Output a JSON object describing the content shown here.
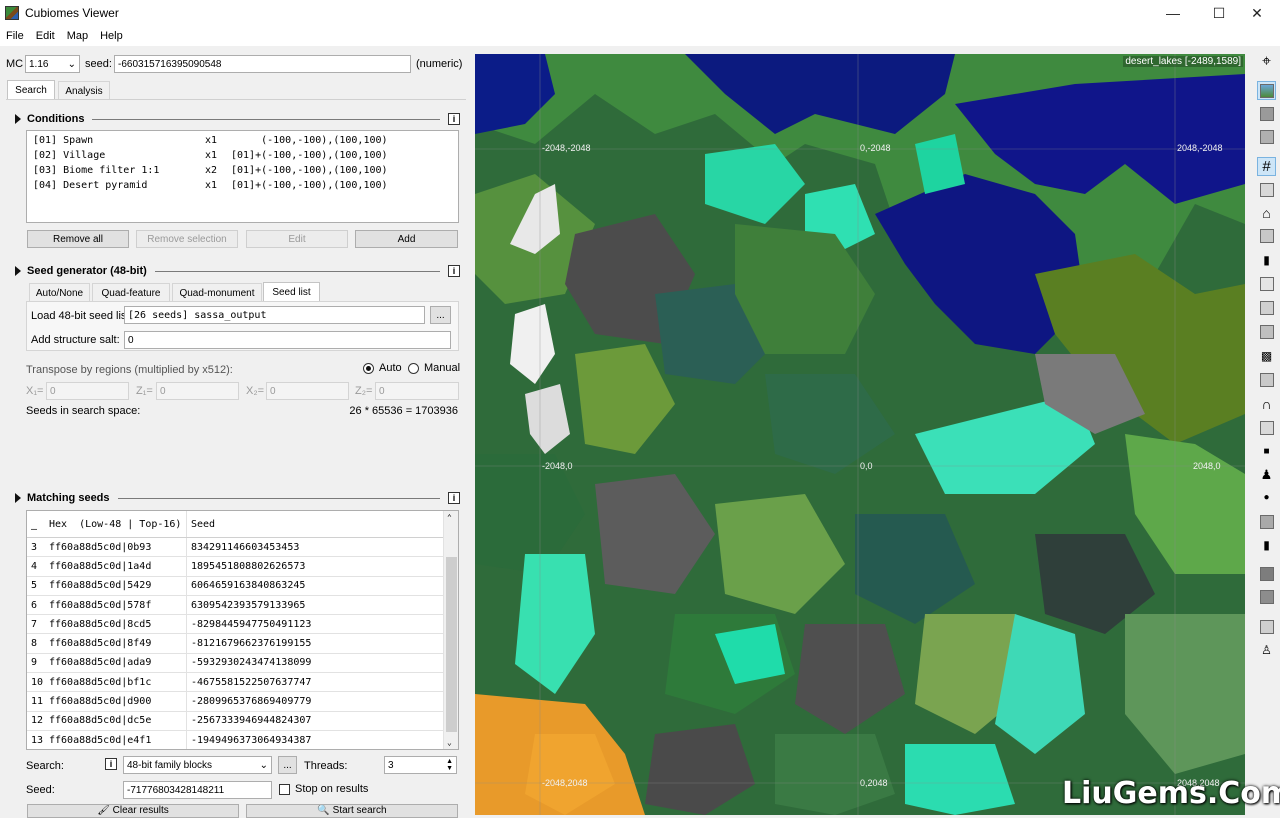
{
  "window": {
    "title": "Cubiomes Viewer",
    "min": "—",
    "max": "☐",
    "close": "✕"
  },
  "menu": [
    "File",
    "Edit",
    "Map",
    "Help"
  ],
  "top": {
    "mc_label": "MC",
    "mc_version": "1.16",
    "seed_label": "seed:",
    "seed_value": "-660315716395090548",
    "seed_mode": "(numeric)"
  },
  "tabs": {
    "search": "Search",
    "analysis": "Analysis"
  },
  "conditions": {
    "title": "Conditions",
    "rows": [
      {
        "id": "[01] Spawn",
        "count": "x1",
        "area": "     (-100,-100),(100,100)"
      },
      {
        "id": "[02] Village",
        "count": "x1",
        "area": "[01]+(-100,-100),(100,100)"
      },
      {
        "id": "[03] Biome filter 1:1",
        "count": "x2",
        "area": "[01]+(-100,-100),(100,100)"
      },
      {
        "id": "[04] Desert pyramid",
        "count": "x1",
        "area": "[01]+(-100,-100),(100,100)"
      }
    ],
    "remove_all": "Remove all",
    "remove_selection": "Remove selection",
    "edit": "Edit",
    "add": "Add"
  },
  "seedgen": {
    "title": "Seed generator (48-bit)",
    "tabs": [
      "Auto/None",
      "Quad-feature",
      "Quad-monument",
      "Seed list"
    ],
    "load_label": "Load 48-bit seed list:",
    "load_value": "[26 seeds] sassa_output",
    "browse": "...",
    "salt_label": "Add structure salt:",
    "salt_value": "0",
    "transpose_label": "Transpose by regions (multiplied by x512):",
    "auto": "Auto",
    "manual": "Manual",
    "x1": "X₁=",
    "z1": "Z₁=",
    "x2": "X₂=",
    "z2": "Z₂=",
    "x1v": "0",
    "z1v": "0",
    "x2v": "0",
    "z2v": "0",
    "space_label": "Seeds in search space:",
    "space_value": "26 * 65536 = 1703936"
  },
  "matching": {
    "title": "Matching seeds",
    "col_hex": "Hex  (Low-48 | Top-16)",
    "col_seed": "Seed",
    "rows": [
      {
        "i": "3",
        "hex": "ff60a88d5c0d|0b93",
        "seed": "834291146603453453"
      },
      {
        "i": "4",
        "hex": "ff60a88d5c0d|1a4d",
        "seed": "1895451808802626573"
      },
      {
        "i": "5",
        "hex": "ff60a88d5c0d|5429",
        "seed": "6064659163840863245"
      },
      {
        "i": "6",
        "hex": "ff60a88d5c0d|578f",
        "seed": "6309542393579133965"
      },
      {
        "i": "7",
        "hex": "ff60a88d5c0d|8cd5",
        "seed": "-8298445947750491123"
      },
      {
        "i": "8",
        "hex": "ff60a88d5c0d|8f49",
        "seed": "-8121679662376199155"
      },
      {
        "i": "9",
        "hex": "ff60a88d5c0d|ada9",
        "seed": "-5932930243474138099"
      },
      {
        "i": "10",
        "hex": "ff60a88d5c0d|bf1c",
        "seed": "-4675581522507637747"
      },
      {
        "i": "11",
        "hex": "ff60a88d5c0d|d900",
        "seed": "-2809965376869409779"
      },
      {
        "i": "12",
        "hex": "ff60a88d5c0d|dc5e",
        "seed": "-2567333946944824307"
      },
      {
        "i": "13",
        "hex": "ff60a88d5c0d|e4f1",
        "seed": "-1949496373064934387"
      }
    ]
  },
  "search": {
    "search_label": "Search:",
    "mode": "48-bit family blocks",
    "dots": "...",
    "threads_label": "Threads:",
    "threads": "3",
    "seed_label": "Seed:",
    "seed_value": "-71776803428148211",
    "stop_label": "Stop on results",
    "clear": "Clear results",
    "start": "Start search"
  },
  "map": {
    "caption": "desert_lakes [-2489,1589]",
    "coords": [
      "-2048,-2048",
      "0,-2048",
      "2048,-2048",
      "-2048,0",
      "0,0",
      "2048,0",
      "-2048,2048",
      "0,2048",
      "2048,2048"
    ]
  },
  "watermark": "LiuGems.Com",
  "colors": {
    "accent": "#0078d7",
    "ocean": "#0a1a7a",
    "forest": "#2f6b3a",
    "jungle": "#5b9a3e",
    "warm_ocean": "#3bdcb0",
    "savanna": "#e0902a"
  }
}
